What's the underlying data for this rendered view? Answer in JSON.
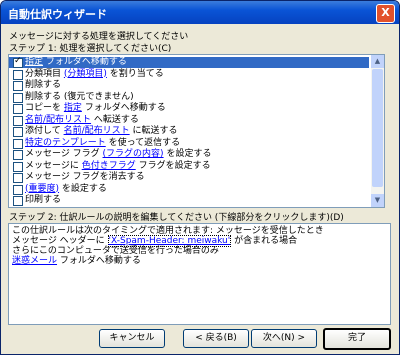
{
  "window": {
    "title": "自動仕訳ウィザード",
    "close_label": "X"
  },
  "intro": "メッセージに対する処理を選択してください",
  "step1_label": "ステップ 1: 処理を選択してください(C)",
  "actions": [
    {
      "checked": true,
      "selected": true,
      "parts": [
        {
          "t": "指定",
          "link": true
        },
        {
          "t": " フォルダへ移動する",
          "link": false
        }
      ]
    },
    {
      "checked": false,
      "selected": false,
      "parts": [
        {
          "t": "分類項目 ",
          "link": false
        },
        {
          "t": "(分類項目)",
          "link": true
        },
        {
          "t": " を割り当てる",
          "link": false
        }
      ]
    },
    {
      "checked": false,
      "selected": false,
      "parts": [
        {
          "t": "削除する",
          "link": false
        }
      ]
    },
    {
      "checked": false,
      "selected": false,
      "parts": [
        {
          "t": "削除する (復元できません)",
          "link": false
        }
      ]
    },
    {
      "checked": false,
      "selected": false,
      "parts": [
        {
          "t": "コピーを ",
          "link": false
        },
        {
          "t": "指定",
          "link": true
        },
        {
          "t": " フォルダへ移動する",
          "link": false
        }
      ]
    },
    {
      "checked": false,
      "selected": false,
      "parts": [
        {
          "t": "名前/配布リスト",
          "link": true
        },
        {
          "t": " へ転送する",
          "link": false
        }
      ]
    },
    {
      "checked": false,
      "selected": false,
      "parts": [
        {
          "t": "添付して ",
          "link": false
        },
        {
          "t": "名前/配布リスト",
          "link": true
        },
        {
          "t": " に転送する",
          "link": false
        }
      ]
    },
    {
      "checked": false,
      "selected": false,
      "parts": [
        {
          "t": "特定のテンプレート",
          "link": true
        },
        {
          "t": " を使って返信する",
          "link": false
        }
      ]
    },
    {
      "checked": false,
      "selected": false,
      "parts": [
        {
          "t": "メッセージ フラグ ",
          "link": false
        },
        {
          "t": "(フラグの内容)",
          "link": true
        },
        {
          "t": " を設定する",
          "link": false
        }
      ]
    },
    {
      "checked": false,
      "selected": false,
      "parts": [
        {
          "t": "メッセージに ",
          "link": false
        },
        {
          "t": "色付きフラグ",
          "link": true
        },
        {
          "t": " フラグを設定する",
          "link": false
        }
      ]
    },
    {
      "checked": false,
      "selected": false,
      "parts": [
        {
          "t": "メッセージ フラグを消去する",
          "link": false
        }
      ]
    },
    {
      "checked": false,
      "selected": false,
      "parts": [
        {
          "t": "(重要度)",
          "link": true
        },
        {
          "t": " を設定する",
          "link": false
        }
      ]
    },
    {
      "checked": false,
      "selected": false,
      "parts": [
        {
          "t": "印刷する",
          "link": false
        }
      ]
    }
  ],
  "step2_label": "ステップ 2: 仕訳ルールの説明を編集してください (下線部分をクリックします)(D)",
  "description": {
    "line1": "この仕訳ルールは次のタイミングで適用されます: メッセージを受信したとき",
    "line2_pre": "メッセージ ヘッダーに ",
    "line2_link": "'X-Spam-Header: meiwaku'",
    "line2_post": " が含まれる場合",
    "line3": "  さらにこのコンピュータで送受信を行った場合のみ",
    "line4_link": "迷惑メール",
    "line4_post": " フォルダへ移動する"
  },
  "buttons": {
    "cancel": "キャンセル",
    "back": "< 戻る(B)",
    "next": "次へ(N) >",
    "finish": "完了"
  }
}
